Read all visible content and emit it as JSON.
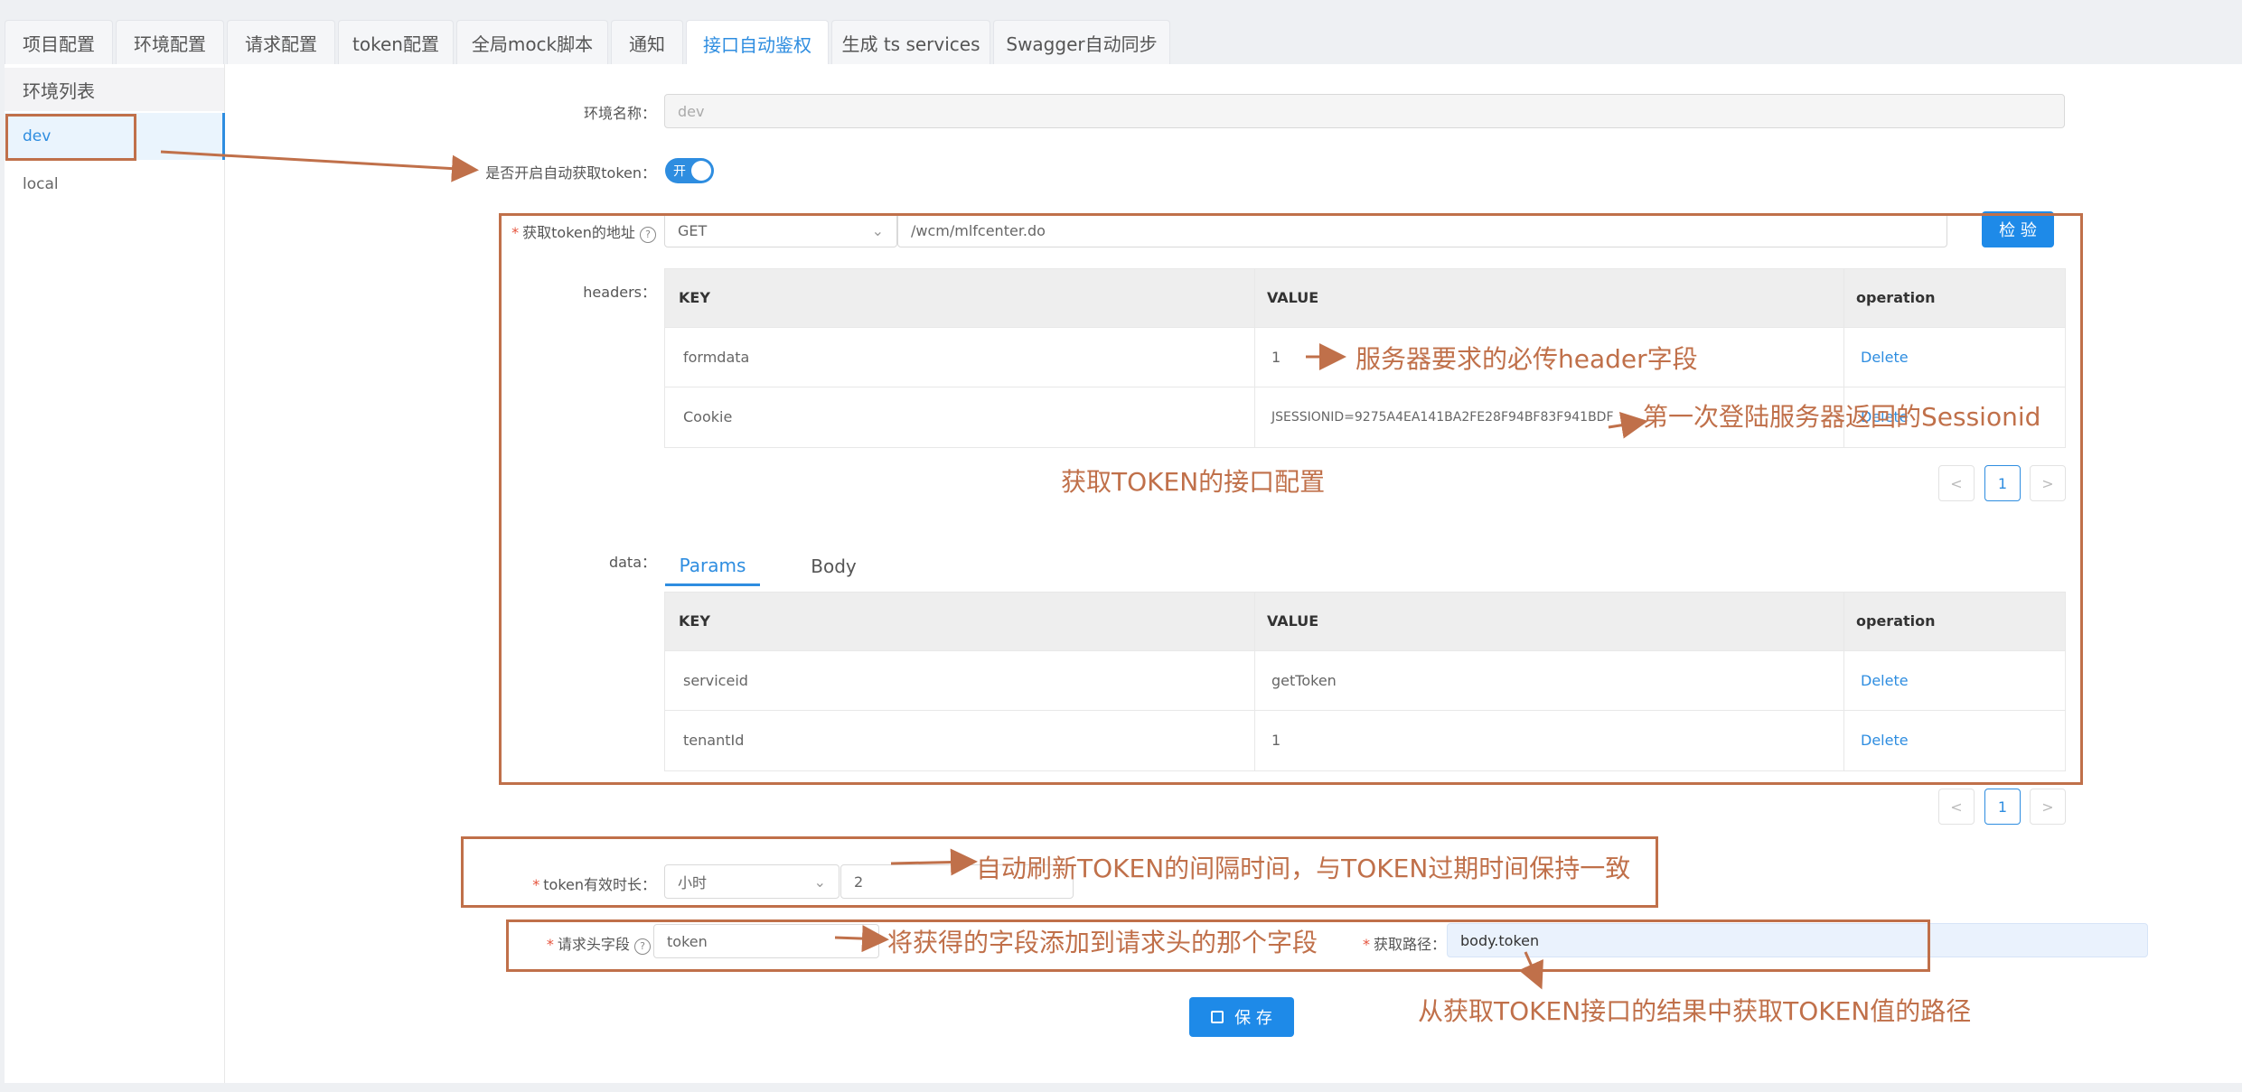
{
  "tabs": [
    {
      "label": "项目配置",
      "active": false
    },
    {
      "label": "环境配置",
      "active": false
    },
    {
      "label": "请求配置",
      "active": false
    },
    {
      "label": "token配置",
      "active": false
    },
    {
      "label": "全局mock脚本",
      "active": false
    },
    {
      "label": "通知",
      "active": false
    },
    {
      "label": "接口自动鉴权",
      "active": true
    },
    {
      "label": "生成 ts services",
      "active": false
    },
    {
      "label": "Swagger自动同步",
      "active": false
    }
  ],
  "sidebar": {
    "title": "环境列表",
    "items": [
      {
        "label": "dev",
        "selected": true
      },
      {
        "label": "local",
        "selected": false
      }
    ]
  },
  "form": {
    "env_name_label": "环境名称：",
    "env_name_value": "dev",
    "auto_token_label": "是否开启自动获取token：",
    "auto_token_switch": "开",
    "token_url_label": "获取token的地址",
    "method": "GET",
    "url": "/wcm/mlfcenter.do",
    "check_button": "检 验",
    "headers_label": "headers：",
    "data_label": "data：",
    "duration_label": "token有效时长：",
    "duration_unit": "小时",
    "duration_value": "2",
    "header_field_label": "请求头字段",
    "header_field_value": "token",
    "path_label": "获取路径：",
    "path_value": "body.token",
    "save_button": "保 存"
  },
  "headers_table": {
    "columns": [
      "KEY",
      "VALUE",
      "operation"
    ],
    "rows": [
      {
        "key": "formdata",
        "value": "1",
        "op": "Delete"
      },
      {
        "key": "Cookie",
        "value": "JSESSIONID=9275A4EA141BA2FE28F94BF83F941BDF",
        "op": "Delete"
      }
    ],
    "page": "1"
  },
  "data_tabs": [
    {
      "label": "Params",
      "active": true
    },
    {
      "label": "Body",
      "active": false
    }
  ],
  "params_table": {
    "columns": [
      "KEY",
      "VALUE",
      "operation"
    ],
    "rows": [
      {
        "key": "serviceid",
        "value": "getToken",
        "op": "Delete"
      },
      {
        "key": "tenantId",
        "value": "1",
        "op": "Delete"
      }
    ],
    "page": "1"
  },
  "pager": {
    "prev": "<",
    "next": ">"
  },
  "annotations": {
    "header_required": "服务器要求的必传header字段",
    "session_id": "第一次登陆服务器返回的Sessionid",
    "token_config": "获取TOKEN的接口配置",
    "refresh_interval": "自动刷新TOKEN的间隔时间，与TOKEN过期时间保持一致",
    "header_field": "将获得的字段添加到请求头的那个字段",
    "token_path": "从获取TOKEN接口的结果中获取TOKEN值的路径"
  },
  "colors": {
    "accent": "#2e8de0",
    "annotation": "#c0704a",
    "required": "#e6533c"
  }
}
